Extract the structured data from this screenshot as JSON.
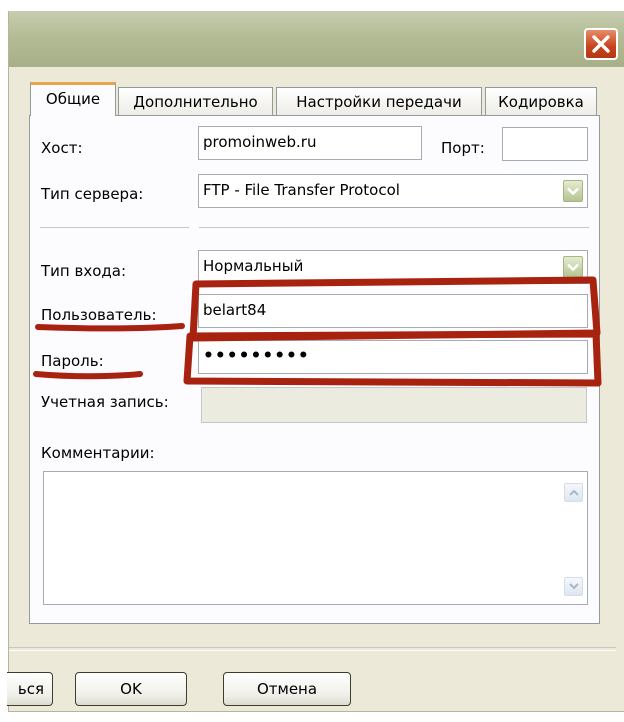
{
  "dialog": {
    "close_icon": "close-x-icon",
    "tabs": [
      {
        "label": "Общие",
        "active": true
      },
      {
        "label": "Дополнительно",
        "active": false
      },
      {
        "label": "Настройки передачи",
        "active": false
      },
      {
        "label": "Кодировка",
        "active": false
      }
    ],
    "general": {
      "host_label": "Хост:",
      "host_value": "promoinweb.ru",
      "port_label": "Порт:",
      "port_value": "",
      "server_type_label": "Тип сервера:",
      "server_type_value": "FTP - File Transfer Protocol",
      "login_type_label": "Тип входа:",
      "login_type_value": "Нормальный",
      "user_label": "Пользователь:",
      "user_value": "belart84",
      "password_label": "Пароль:",
      "password_value": "•••••••••",
      "account_label": "Учетная запись:",
      "account_value": "",
      "comments_label": "Комментарии:",
      "comments_value": ""
    },
    "buttons": {
      "connect_partial": "ься",
      "ok": "OK",
      "cancel": "Отмена"
    }
  },
  "annotation": {
    "color": "#a8230f"
  }
}
